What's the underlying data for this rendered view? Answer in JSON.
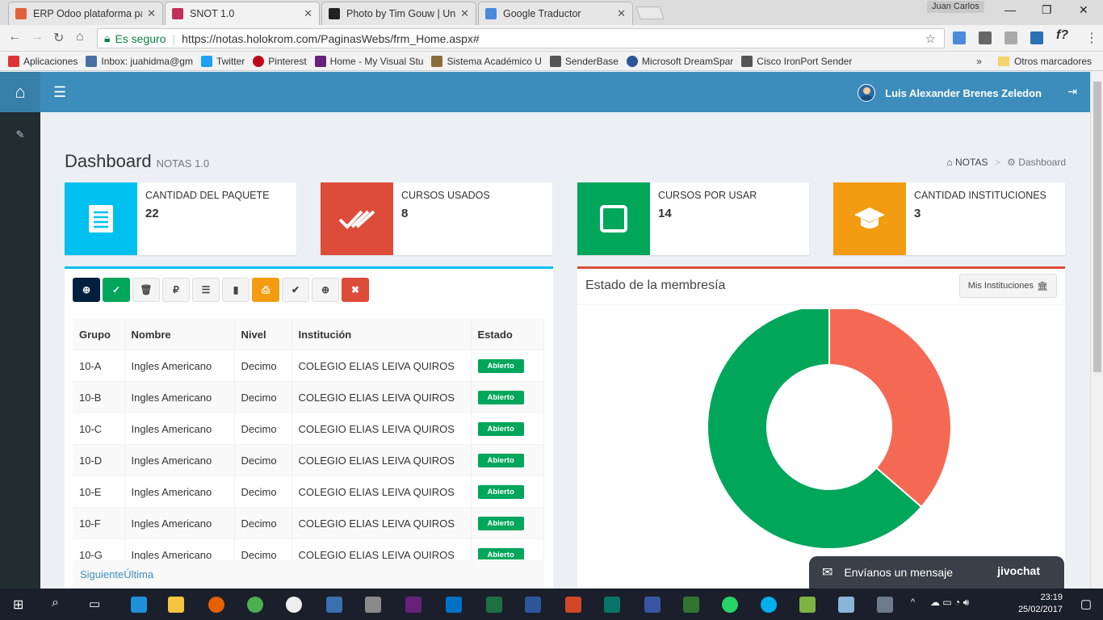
{
  "browser": {
    "tabs": [
      {
        "label": "ERP Odoo plataforma pa",
        "color": "#e0603a"
      },
      {
        "label": "SNOT 1.0",
        "color": "#c0305a"
      },
      {
        "label": "Photo by Tim Gouw | Uns",
        "color": "#222222"
      },
      {
        "label": "Google Traductor",
        "color": "#4a89dc"
      }
    ],
    "user": "Juan Carlos",
    "secure_label": "Es seguro",
    "url": "https://notas.holokrom.com/PaginasWebs/frm_Home.aspx#",
    "bookmarks": [
      "Aplicaciones",
      "Inbox: juahidma@gm",
      "Twitter",
      "Pinterest",
      "Home - My Visual Stu",
      "Sistema Académico U",
      "SenderBase",
      "Microsoft DreamSpar",
      "Cisco IronPort Sender"
    ],
    "other_bookmarks": "Otros marcadores"
  },
  "app": {
    "user_name": "Luis Alexander Brenes Zeledon",
    "page_title": "Dashboard",
    "page_subtitle": "NOTAS 1.0",
    "breadcrumb": [
      "NOTAS",
      "Dashboard"
    ],
    "accent": "#3c8dbc"
  },
  "info_boxes": [
    {
      "label": "CANTIDAD DEL PAQUETE",
      "value": "22",
      "color": "#00c0ef",
      "icon": "document-icon"
    },
    {
      "label": "CURSOS USADOS",
      "value": "8",
      "color": "#dd4b39",
      "icon": "double-check-icon"
    },
    {
      "label": "CURSOS POR USAR",
      "value": "14",
      "color": "#00a65a",
      "icon": "empty-square-icon"
    },
    {
      "label": "CANTIDAD INSTITUCIONES",
      "value": "3",
      "color": "#f39c12",
      "icon": "graduation-cap-icon"
    }
  ],
  "table": {
    "headers": [
      "Grupo",
      "Nombre",
      "Nivel",
      "Institución",
      "Estado"
    ],
    "rows": [
      [
        "10-A",
        "Ingles Americano",
        "Decimo",
        "COLEGIO ELIAS LEIVA QUIROS",
        "Abierto"
      ],
      [
        "10-B",
        "Ingles Americano",
        "Decimo",
        "COLEGIO ELIAS LEIVA QUIROS",
        "Abierto"
      ],
      [
        "10-C",
        "Ingles Americano",
        "Decimo",
        "COLEGIO ELIAS LEIVA QUIROS",
        "Abierto"
      ],
      [
        "10-D",
        "Ingles Americano",
        "Decimo",
        "COLEGIO ELIAS LEIVA QUIROS",
        "Abierto"
      ],
      [
        "10-E",
        "Ingles Americano",
        "Decimo",
        "COLEGIO ELIAS LEIVA QUIROS",
        "Abierto"
      ],
      [
        "10-F",
        "Ingles Americano",
        "Decimo",
        "COLEGIO ELIAS LEIVA QUIROS",
        "Abierto"
      ],
      [
        "10-G",
        "Ingles Americano",
        "Decimo",
        "COLEGIO ELIAS LEIVA QUIROS",
        "Abierto"
      ]
    ],
    "pager": "SiguienteÚltima"
  },
  "membership": {
    "title": "Estado de la membresía",
    "button": "Mis Instituciones",
    "slices": [
      {
        "value": 8,
        "color": "#f56954"
      },
      {
        "value": 14,
        "color": "#00a65a"
      }
    ]
  },
  "chat": {
    "label": "Envíanos un mensaje",
    "brand": "jivochat"
  },
  "system": {
    "time": "23:19",
    "date": "25/02/2017"
  }
}
